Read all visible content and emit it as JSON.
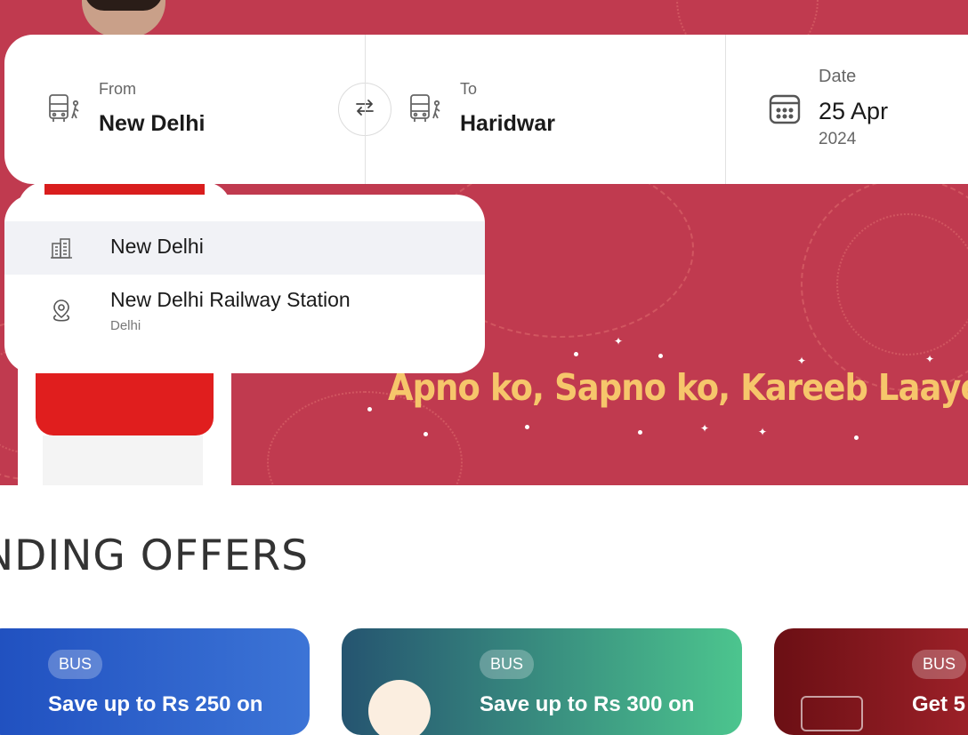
{
  "banner": {
    "tagline": "Apno ko, Sapno ko, Kareeb Laaye."
  },
  "search": {
    "from": {
      "label": "From",
      "value": "New Delhi",
      "icon": "bus-stop-icon"
    },
    "swap_icon": "swap-icon",
    "to": {
      "label": "To",
      "value": "Haridwar",
      "icon": "bus-stop-icon"
    },
    "date": {
      "label": "Date",
      "day_month": "25 Apr",
      "year": "2024",
      "icon": "calendar-icon"
    }
  },
  "suggestions": [
    {
      "title": "New Delhi",
      "subtitle": "",
      "icon": "city-icon"
    },
    {
      "title": "New Delhi Railway Station",
      "subtitle": "Delhi",
      "icon": "location-pin-icon"
    }
  ],
  "offers_section": {
    "title": "NDING OFFERS"
  },
  "offers": [
    {
      "badge": "BUS",
      "text": "Save up to Rs 250 on",
      "color_start": "#1f4fbf",
      "color_end": "#3c74d6"
    },
    {
      "badge": "BUS",
      "text": "Save up to Rs 300 on",
      "color_start": "#255470",
      "color_end": "#4cc58e"
    },
    {
      "badge": "BUS",
      "text": "Get 5",
      "color_start": "#6b0f14",
      "color_end": "#a0222a"
    }
  ],
  "colors": {
    "banner_bg": "#c03a4f",
    "tagline": "#f6c66b"
  }
}
